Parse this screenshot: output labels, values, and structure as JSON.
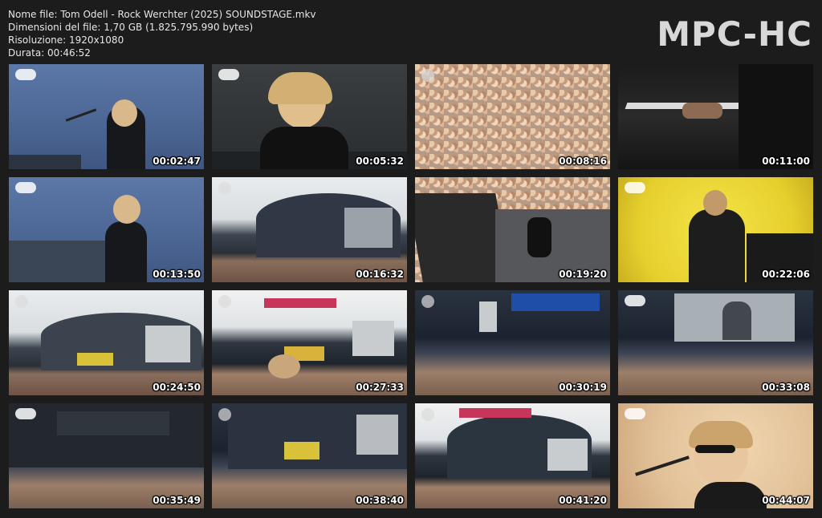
{
  "header": {
    "file_name": "Nome file: Tom Odell - Rock Werchter (2025) SOUNDSTAGE.mkv",
    "file_size": "Dimensioni del file: 1,70 GB (1.825.795.990 bytes)",
    "resolution": "Risoluzione: 1920x1080",
    "duration": "Durata: 00:46:52"
  },
  "logo": "MPC-HC",
  "thumbnails": [
    {
      "time": "00:02:47",
      "scene": "blue"
    },
    {
      "time": "00:05:32",
      "scene": "dark"
    },
    {
      "time": "00:08:16",
      "scene": "crowd"
    },
    {
      "time": "00:11:00",
      "scene": "piano"
    },
    {
      "time": "00:13:50",
      "scene": "blue"
    },
    {
      "time": "00:16:32",
      "scene": "stage"
    },
    {
      "time": "00:19:20",
      "scene": "dark"
    },
    {
      "time": "00:22:06",
      "scene": "yellow"
    },
    {
      "time": "00:24:50",
      "scene": "stage"
    },
    {
      "time": "00:27:33",
      "scene": "stage2"
    },
    {
      "time": "00:30:19",
      "scene": "night"
    },
    {
      "time": "00:33:08",
      "scene": "stage"
    },
    {
      "time": "00:35:49",
      "scene": "night"
    },
    {
      "time": "00:38:40",
      "scene": "night"
    },
    {
      "time": "00:41:20",
      "scene": "stage2"
    },
    {
      "time": "00:44:07",
      "scene": "face"
    }
  ]
}
